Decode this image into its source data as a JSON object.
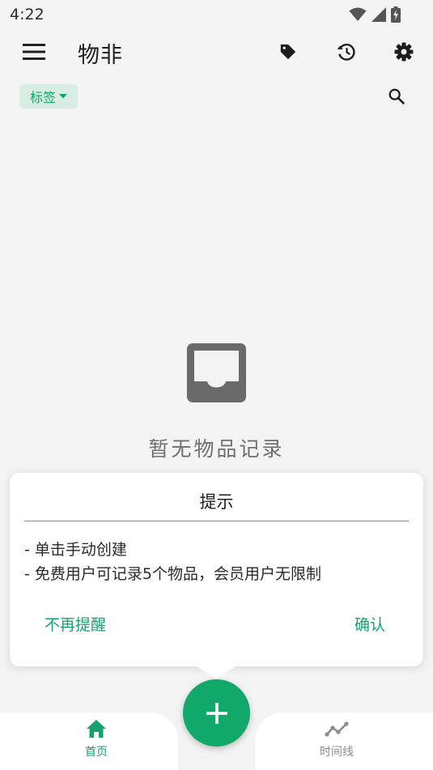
{
  "status_bar": {
    "time": "4:22",
    "icons": [
      "wifi-icon",
      "cellular-signal-icon",
      "battery-charging-icon"
    ]
  },
  "app_bar": {
    "title": "物非",
    "actions": [
      "tag-icon",
      "history-icon",
      "settings-icon"
    ]
  },
  "filter": {
    "chip_label": "标签",
    "search_icon": "search-icon"
  },
  "empty_state": {
    "icon": "inbox-icon",
    "message": "暂无物品记录"
  },
  "tip_dialog": {
    "title": "提示",
    "lines": [
      "- 单击手动创建",
      "- 免费用户可记录5个物品，会员用户无限制"
    ],
    "dismiss_label": "不再提醒",
    "confirm_label": "确认"
  },
  "bottom_nav": {
    "items": [
      {
        "label": "首页",
        "icon": "home-icon",
        "active": true
      },
      {
        "label": "时间线",
        "icon": "timeline-icon",
        "active": false
      }
    ],
    "fab_icon": "plus-icon"
  },
  "colors": {
    "accent": "#13a36b",
    "fab": "#11a96a",
    "chip_bg": "#d9eee2",
    "background": "#f3f3f3",
    "inactive": "#8c8c8c"
  }
}
